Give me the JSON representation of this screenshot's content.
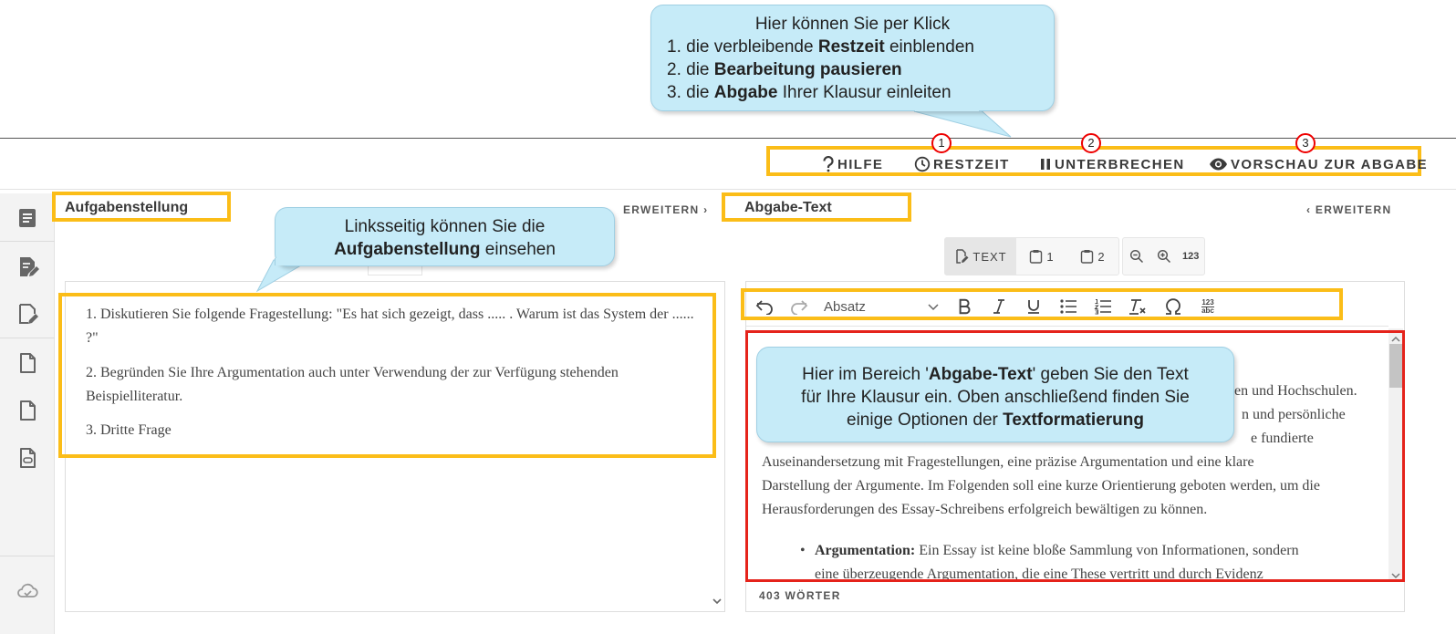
{
  "colors": {
    "highlight": "#fbbd18",
    "callout_bg": "#c6ebf8",
    "editor_border": "#e5231b",
    "badge_ring": "#e00000"
  },
  "top_actions": [
    {
      "label": "HILFE",
      "icon": "question-icon"
    },
    {
      "label": "RESTZEIT",
      "icon": "clock-icon",
      "badge": "1"
    },
    {
      "label": "UNTERBRECHEN",
      "icon": "pause-icon",
      "badge": "2"
    },
    {
      "label": "VORSCHAU ZUR ABGABE",
      "icon": "eye-icon",
      "badge": "3"
    }
  ],
  "callout_top": {
    "line1": "Hier können Sie per Klick",
    "item1_pre": "1. die verbleibende ",
    "item1_bold": "Restzeit",
    "item1_post": " einblenden",
    "item2_pre": "2. die ",
    "item2_bold": "Bearbeitung pausieren",
    "item3_pre": "3. die ",
    "item3_bold": "Abgabe",
    "item3_post": " Ihrer Klausur einleiten"
  },
  "callout_left": {
    "line1": "Linksseitig können Sie die",
    "bold": "Aufgabenstellung",
    "post": " einsehen"
  },
  "callout_editor": {
    "pre1": "Hier im Bereich '",
    "bold1": "Abgabe-Text",
    "post1": "' geben Sie den Text",
    "line2": "für Ihre Klausur ein. Oben anschließend finden Sie",
    "pre3": "einige Optionen der ",
    "bold3": "Textformatierung"
  },
  "left_panel": {
    "title": "Aufgabenstellung",
    "expand": "ERWEITERN ›",
    "tasks": [
      "1. Diskutieren Sie folgende Fragestellung: \"Es hat sich gezeigt, dass ..... . Warum ist das System der ......   ?\"",
      "2. Begründen Sie Ihre Argumentation auch unter Verwendung der zur Verfügung stehenden Beispielliteratur.",
      "3. Dritte Frage"
    ]
  },
  "right_panel": {
    "title": "Abgabe-Text",
    "expand": "‹ ERWEITERN",
    "view_buttons": [
      {
        "label": "TEXT",
        "icon": "edit-doc-icon"
      },
      {
        "label": "1",
        "icon": "clipboard-icon"
      },
      {
        "label": "2",
        "icon": "clipboard-icon"
      }
    ],
    "zoom_buttons": [
      {
        "icon": "zoom-out-icon"
      },
      {
        "icon": "zoom-in-icon"
      },
      {
        "label": "123",
        "icon": "count-icon"
      }
    ],
    "paragraph_style": "Absatz",
    "char_map_label_top": "123",
    "char_map_label_bottom": "abc",
    "visible_fragments": [
      "en und Hochschulen.",
      "n und persönliche",
      "e fundierte"
    ],
    "paragraph_lines": [
      "Auseinandersetzung mit Fragestellungen, eine präzise Argumentation und eine klare",
      "Darstellung der Argumente. Im Folgenden soll eine kurze Orientierung geboten werden, um die",
      "Herausforderungen des Essay-Schreibens erfolgreich bewältigen zu können."
    ],
    "bullet_bold": "Argumentation:",
    "bullet_text": " Ein Essay ist keine bloße Sammlung von Informationen, sondern",
    "bullet_line2": "eine überzeugende Argumentation, die eine These vertritt und durch Evidenz",
    "word_count": "403 WÖRTER"
  }
}
